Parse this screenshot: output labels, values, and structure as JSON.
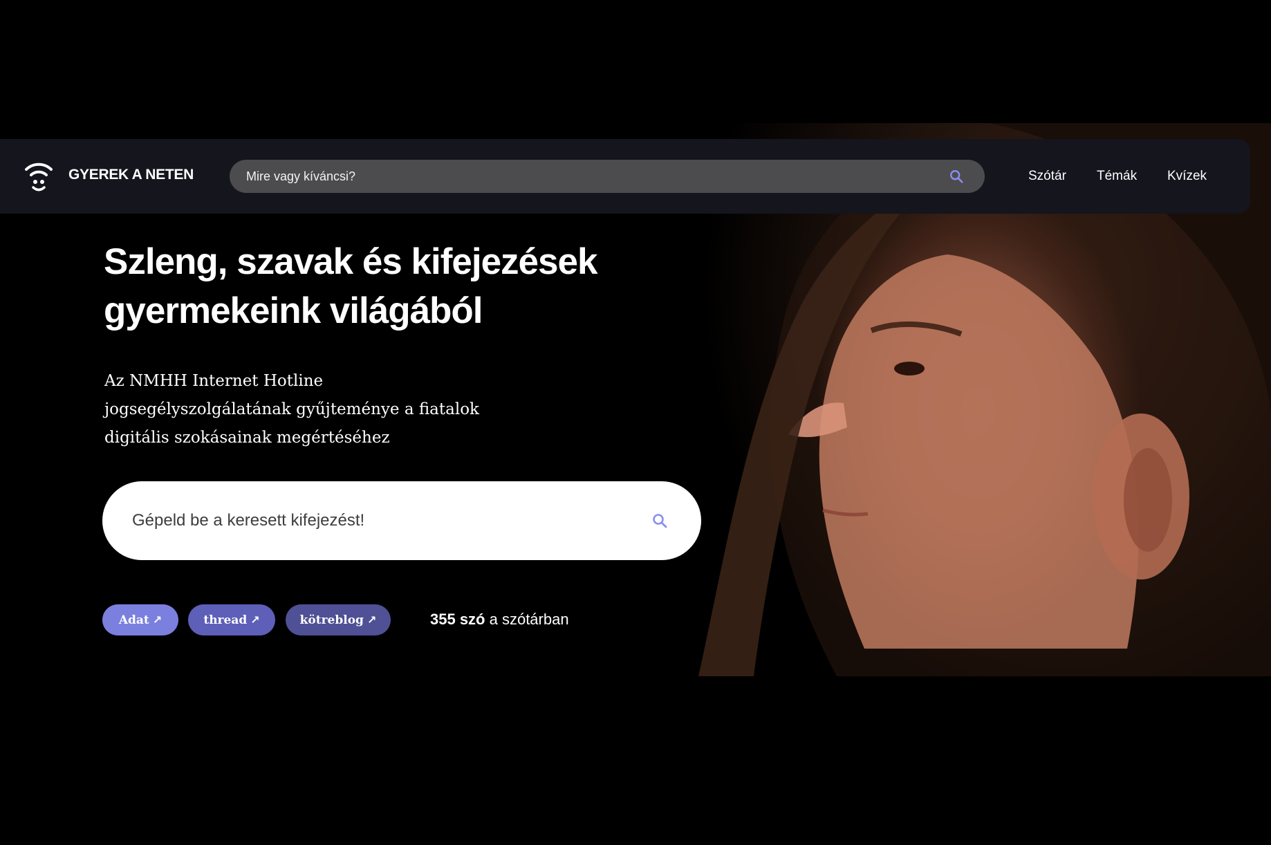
{
  "navbar": {
    "logo_text": "GYEREK A NETEN",
    "search_placeholder": "Mire vagy kíváncsi?",
    "links": [
      {
        "label": "Szótár"
      },
      {
        "label": "Témák"
      },
      {
        "label": "Kvízek"
      }
    ]
  },
  "hero": {
    "title_line1": "Szleng, szavak és kifejezések",
    "title_line2": "gyermekeink világából",
    "description_line1": "Az NMHH Internet Hotline",
    "description_line2": "jogsegélyszolgálatának gyűjteménye a fiatalok",
    "description_line3": "digitális szokásainak megértéséhez",
    "search_placeholder": "Gépeld be a keresett kifejezést!",
    "tags": [
      {
        "label": "Adat",
        "color": "#7b80de"
      },
      {
        "label": "thread",
        "color": "#5e5fb8"
      },
      {
        "label": "kötreblog",
        "color": "#4f5095"
      }
    ],
    "stat_count": "355 szó",
    "stat_suffix": " a szótárban"
  },
  "icons": {
    "logo": "wifi-smiley-icon",
    "search": "search-icon",
    "external": "arrow-up-right-icon"
  },
  "colors": {
    "background": "#000000",
    "navbar": "#14151d",
    "nav_search": "#4c4c4f",
    "accent": "#7b80de"
  }
}
